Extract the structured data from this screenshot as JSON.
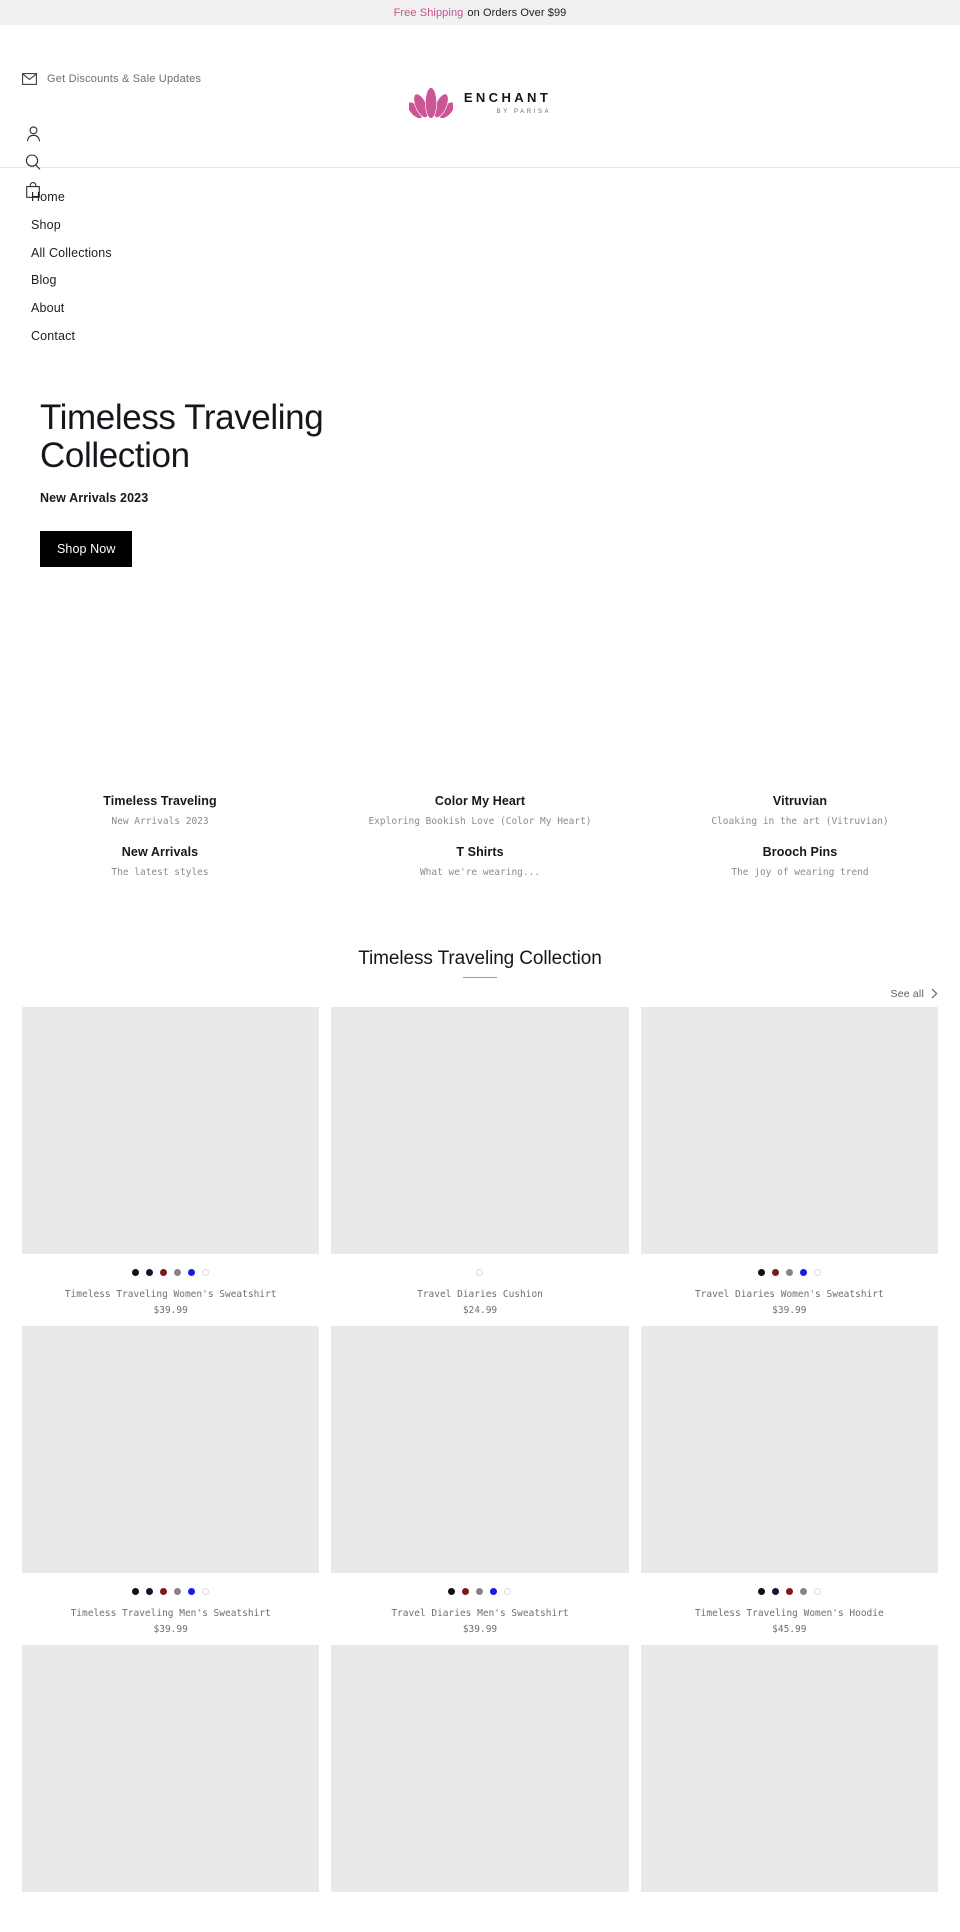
{
  "announcement": {
    "highlight": "Free Shipping",
    "rest": "on Orders Over $99"
  },
  "header": {
    "promo_label": "Get Discounts & Sale Updates",
    "brand_name": "ENCHANT",
    "brand_sub": "BY PARISA"
  },
  "nav": {
    "items": [
      {
        "label": "Home"
      },
      {
        "label": "Shop"
      },
      {
        "label": "All Collections"
      },
      {
        "label": "Blog"
      },
      {
        "label": "About"
      },
      {
        "label": "Contact"
      }
    ]
  },
  "hero": {
    "title": "Timeless Traveling Collection",
    "subtitle": "New Arrivals 2023",
    "cta": "Shop Now"
  },
  "tiles": [
    {
      "title": "Timeless Traveling",
      "sub": "New Arrivals 2023"
    },
    {
      "title": "Color My Heart",
      "sub": "Exploring Bookish Love (Color My Heart)"
    },
    {
      "title": "Vitruvian",
      "sub": "Cloaking in the art (Vitruvian)"
    },
    {
      "title": "New Arrivals",
      "sub": "The latest styles"
    },
    {
      "title": "T Shirts",
      "sub": "What we're wearing..."
    },
    {
      "title": "Brooch Pins",
      "sub": "The joy of wearing trend"
    }
  ],
  "section": {
    "title": "Timeless Traveling Collection",
    "see_all": "See all"
  },
  "colors": {
    "accent_pink": "#c4548c",
    "rule_mauve": "#c08ca0",
    "swatch_black": "#111111",
    "swatch_navy": "#15152e",
    "swatch_darkred": "#7c1919",
    "swatch_gray": "#858585",
    "swatch_blue": "#1a1ae6",
    "swatch_white": "#ffffff",
    "placeholder_gray": "#e9e9e9"
  },
  "products": [
    {
      "name": "Timeless Traveling Women's Sweatshirt",
      "price": "$39.99",
      "swatches": [
        "#111111",
        "#15152e",
        "#7c1919",
        "#858585",
        "#1a1ae6",
        "empty"
      ]
    },
    {
      "name": "Travel Diaries Cushion",
      "price": "$24.99",
      "swatches": [
        "empty"
      ]
    },
    {
      "name": "Travel Diaries Women's Sweatshirt",
      "price": "$39.99",
      "swatches": [
        "#111111",
        "#7c1919",
        "#858585",
        "#1a1ae6",
        "empty"
      ]
    },
    {
      "name": "Timeless Traveling Men's Sweatshirt",
      "price": "$39.99",
      "swatches": [
        "#111111",
        "#15152e",
        "#7c1919",
        "#858585",
        "#1a1ae6",
        "empty"
      ]
    },
    {
      "name": "Travel Diaries Men's Sweatshirt",
      "price": "$39.99",
      "swatches": [
        "#111111",
        "#7c1919",
        "#858585",
        "#1a1ae6",
        "empty"
      ]
    },
    {
      "name": "Timeless Traveling Women's Hoodie",
      "price": "$45.99",
      "swatches": [
        "#111111",
        "#15152e",
        "#7c1919",
        "#858585",
        "empty"
      ]
    },
    {
      "name": "",
      "price": "",
      "swatches": []
    },
    {
      "name": "",
      "price": "",
      "swatches": []
    },
    {
      "name": "",
      "price": "",
      "swatches": []
    }
  ]
}
